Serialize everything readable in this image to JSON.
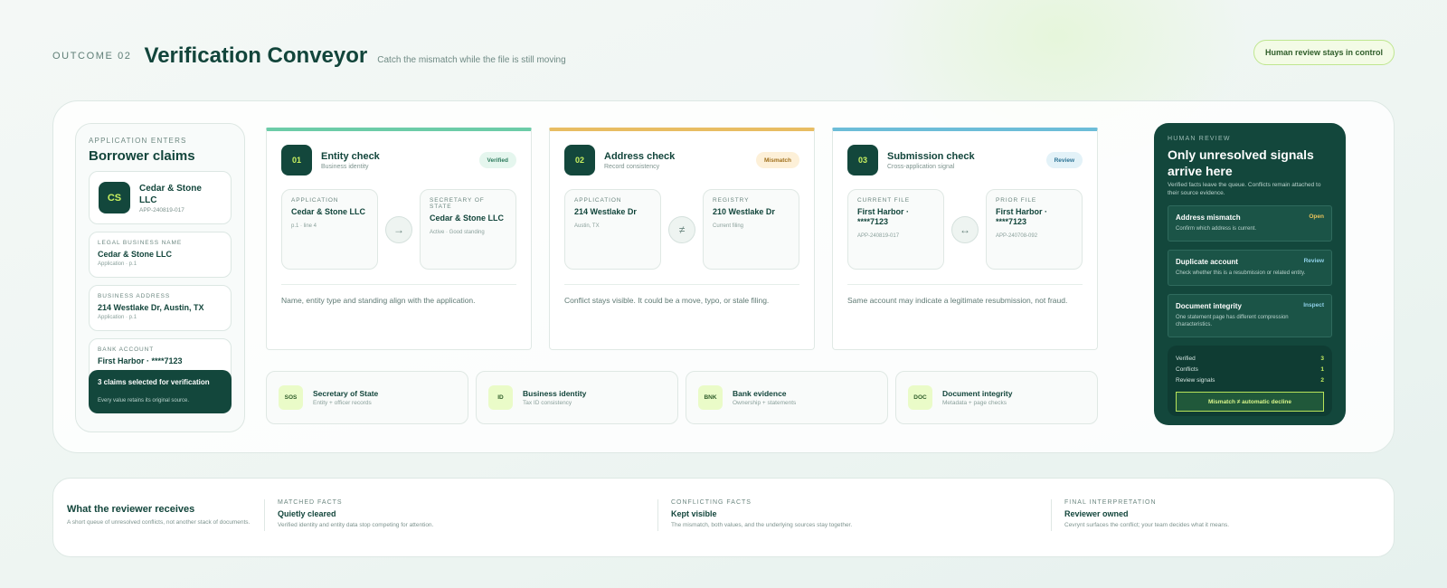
{
  "header": {
    "outcome": "OUTCOME 02",
    "title": "Verification Conveyor",
    "subtitle": "Catch the mismatch while the file is still moving",
    "control_pill": "Human review stays in control"
  },
  "claims": {
    "eyebrow": "APPLICATION ENTERS",
    "title": "Borrower claims",
    "entity": {
      "initials": "CS",
      "name": "Cedar & Stone LLC",
      "id": "APP-240819-017"
    },
    "fields": [
      {
        "label": "LEGAL BUSINESS NAME",
        "value": "Cedar & Stone LLC",
        "source": "Application · p.1"
      },
      {
        "label": "BUSINESS ADDRESS",
        "value": "214 Westlake Dr, Austin, TX",
        "source": "Application · p.1"
      },
      {
        "label": "BANK ACCOUNT",
        "value": "First Harbor · ****7123",
        "source": ""
      }
    ],
    "banner": {
      "title": "3 claims selected for verification",
      "sub": "Every value retains its original source."
    }
  },
  "checks": [
    {
      "num": "01",
      "title": "Entity check",
      "sub": "Business identity",
      "status": "Verified",
      "accent": "#6ccca8",
      "status_bg": "#e5f6ee",
      "status_fg": "#2c7a5c",
      "left": {
        "label": "APPLICATION",
        "value": "Cedar & Stone LLC",
        "note": "p.1 · line 4"
      },
      "op": "→",
      "right": {
        "label": "SECRETARY OF STATE",
        "value": "Cedar & Stone LLC",
        "note": "Active · Good standing"
      },
      "foot": "Name, entity type and standing align with the application."
    },
    {
      "num": "02",
      "title": "Address check",
      "sub": "Record consistency",
      "status": "Mismatch",
      "accent": "#e8bd63",
      "status_bg": "#fdf0d8",
      "status_fg": "#a0701c",
      "left": {
        "label": "APPLICATION",
        "value": "214 Westlake Dr",
        "note": "Austin, TX"
      },
      "op": "≠",
      "right": {
        "label": "REGISTRY",
        "value": "210 Westlake Dr",
        "note": "Current filing"
      },
      "foot": "Conflict stays visible. It could be a move, typo, or stale filing."
    },
    {
      "num": "03",
      "title": "Submission check",
      "sub": "Cross-application signal",
      "status": "Review",
      "accent": "#6cbdd8",
      "status_bg": "#e3f2f8",
      "status_fg": "#2b7395",
      "left": {
        "label": "CURRENT FILE",
        "value": "First Harbor · ****7123",
        "note": "APP-240819-017"
      },
      "op": "↔",
      "right": {
        "label": "PRIOR FILE",
        "value": "First Harbor · ****7123",
        "note": "APP-240708-092"
      },
      "foot": "Same account may indicate a legitimate resubmission, not fraud."
    }
  ],
  "sources": [
    {
      "code": "SOS",
      "name": "Secretary of State",
      "sub": "Entity + officer records"
    },
    {
      "code": "ID",
      "name": "Business identity",
      "sub": "Tax ID consistency"
    },
    {
      "code": "BNK",
      "name": "Bank evidence",
      "sub": "Ownership + statements"
    },
    {
      "code": "DOC",
      "name": "Document integrity",
      "sub": "Metadata + page checks"
    }
  ],
  "review": {
    "eyebrow": "HUMAN REVIEW",
    "title": "Only unresolved signals arrive here",
    "sub": "Verified facts leave the queue. Conflicts remain attached to their source evidence.",
    "signals": [
      {
        "title": "Address mismatch",
        "status": "Open",
        "color": "#e8c25a",
        "sub": "Confirm which address is current."
      },
      {
        "title": "Duplicate account",
        "status": "Review",
        "color": "#8fd0e8",
        "sub": "Check whether this is a resubmission or related entity."
      },
      {
        "title": "Document integrity",
        "status": "Inspect",
        "color": "#8fd0e8",
        "sub": "One statement page has different compression characteristics."
      }
    ],
    "tally": [
      {
        "label": "Verified",
        "value": "3"
      },
      {
        "label": "Conflicts",
        "value": "1"
      },
      {
        "label": "Review signals",
        "value": "2"
      }
    ],
    "banner": "Mismatch ≠ automatic decline"
  },
  "bottom": {
    "lead_title": "What the reviewer receives",
    "lead_sub": "A short queue of unresolved conflicts, not another stack of documents.",
    "cols": [
      {
        "eyebrow": "MATCHED FACTS",
        "title": "Quietly cleared",
        "sub": "Verified identity and entity data stop competing for attention."
      },
      {
        "eyebrow": "CONFLICTING FACTS",
        "title": "Kept visible",
        "sub": "The mismatch, both values, and the underlying sources stay together."
      },
      {
        "eyebrow": "FINAL INTERPRETATION",
        "title": "Reviewer owned",
        "sub": "Cevrynt surfaces the conflict; your team decides what it means."
      }
    ]
  }
}
